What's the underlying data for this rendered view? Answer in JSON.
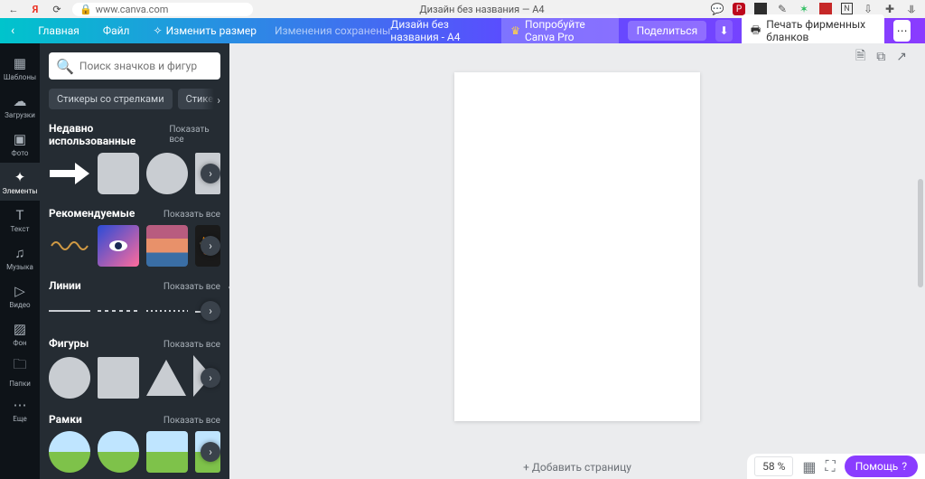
{
  "browser": {
    "url": "www.canva.com",
    "tab_title": "Дизайн без названия — A4",
    "ext_icons": [
      "pinterest",
      "evernote-dark",
      "pencil",
      "evernote",
      "abbyy",
      "notion",
      "save",
      "sync",
      "download"
    ]
  },
  "appbar": {
    "home": "Главная",
    "file": "Файл",
    "resize": "Изменить размер",
    "saved": "Изменения сохранены",
    "doc_title": "Дизайн без названия - A4",
    "try_pro": "Попробуйте Canva Pro",
    "share": "Поделиться",
    "print": "Печать фирменных бланков"
  },
  "rail": [
    {
      "icon": "templates",
      "label": "Шаблоны"
    },
    {
      "icon": "uploads",
      "label": "Загрузки"
    },
    {
      "icon": "photo",
      "label": "Фото"
    },
    {
      "icon": "elements",
      "label": "Элементы",
      "active": true
    },
    {
      "icon": "text",
      "label": "Текст"
    },
    {
      "icon": "music",
      "label": "Музыка"
    },
    {
      "icon": "video",
      "label": "Видео"
    },
    {
      "icon": "background",
      "label": "Фон"
    },
    {
      "icon": "folders",
      "label": "Папки"
    },
    {
      "icon": "more",
      "label": "Еще"
    }
  ],
  "panel": {
    "search_placeholder": "Поиск значков и фигур",
    "chips": [
      "Стикеры со стрелками",
      "Стикеры с фигурами"
    ],
    "show_all": "Показать все",
    "sections": {
      "recent": "Недавно использованные",
      "recommended": "Рекомендуемые",
      "lines": "Линии",
      "shapes": "Фигуры",
      "frames": "Рамки"
    }
  },
  "canvas": {
    "add_page": "+ Добавить страницу",
    "zoom": "58 %",
    "help": "Помощь"
  }
}
